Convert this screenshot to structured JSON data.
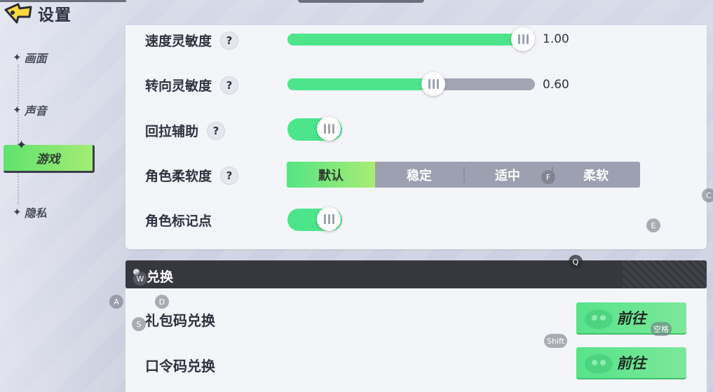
{
  "header": {
    "title": "设置"
  },
  "sidebar": {
    "items": [
      {
        "label": "画面",
        "active": false
      },
      {
        "label": "声音",
        "active": false
      },
      {
        "label": "游戏",
        "active": true
      },
      {
        "label": "隐私",
        "active": false
      }
    ]
  },
  "settings": {
    "speed_sensitivity": {
      "label": "速度灵敏度",
      "value_text": "1.00",
      "level": 1.0
    },
    "turn_sensitivity": {
      "label": "转向灵敏度",
      "value_text": "0.60",
      "level": 0.6
    },
    "pullback_assist": {
      "label": "回拉辅助",
      "on": true
    },
    "character_softness": {
      "label": "角色柔软度",
      "options": [
        "默认",
        "稳定",
        "适中",
        "柔软"
      ],
      "selected": "默认"
    },
    "character_marker": {
      "label": "角色标记点",
      "on": true
    }
  },
  "redeem": {
    "section_title": "兑换",
    "gift_code": {
      "label": "礼包码兑换",
      "button": "前往"
    },
    "password_code": {
      "label": "口令码兑换",
      "button": "前往"
    }
  },
  "key_hints": {
    "f": "F",
    "c": "C",
    "e": "E",
    "q": "Q",
    "w": "W",
    "a": "A",
    "d": "D",
    "s": "S",
    "shift": "Shift",
    "space": "空格"
  },
  "colors": {
    "accent_green": "#4de58c",
    "slider_track": "#a3a5b5",
    "section_header": "#37383f",
    "card_bg": "#f4f5f9"
  }
}
